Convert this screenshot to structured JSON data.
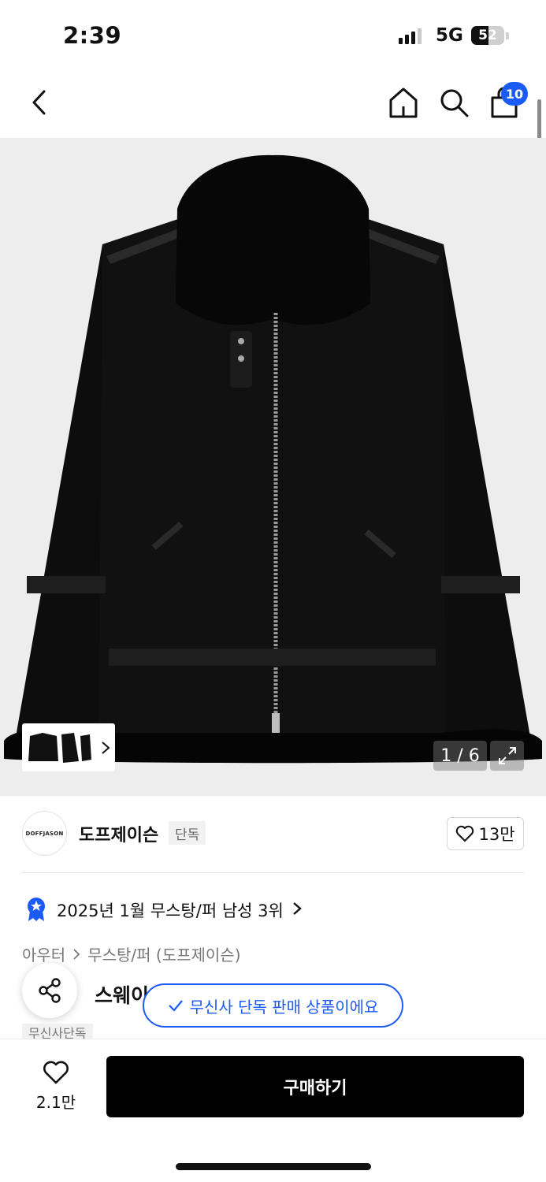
{
  "status_bar": {
    "time": "2:39",
    "network": "5G",
    "battery": "52",
    "battery_level": 0.52
  },
  "nav": {
    "back_icon": "chevron-left-icon",
    "home_icon": "home-icon",
    "search_icon": "search-icon",
    "cart_icon": "shopping-bag-icon",
    "cart_count": "10"
  },
  "gallery": {
    "pager": "1 / 6",
    "expand_icon": "expand-icon",
    "thumbnail_next_icon": "chevron-right-icon"
  },
  "brand": {
    "logo_text": "DOFFJASON",
    "name": "도프제이슨",
    "exclusive_tag": "단독",
    "like_count": "13만"
  },
  "ranking": {
    "text": "2025년 1월 무스탕/퍼 남성 3위"
  },
  "breadcrumb": {
    "items": [
      "아우터",
      "무스탕/퍼 (도프제이슨)"
    ]
  },
  "product": {
    "title_visible": "스웨이",
    "tag": "무신사단독"
  },
  "toast": {
    "text": "무신사 단독 판매 상품이에요"
  },
  "bottom_bar": {
    "wish_count": "2.1만",
    "buy_label": "구매하기"
  },
  "colors": {
    "accent": "#1b5bf5",
    "buy_button": "#000000",
    "image_bg": "#ededed"
  }
}
